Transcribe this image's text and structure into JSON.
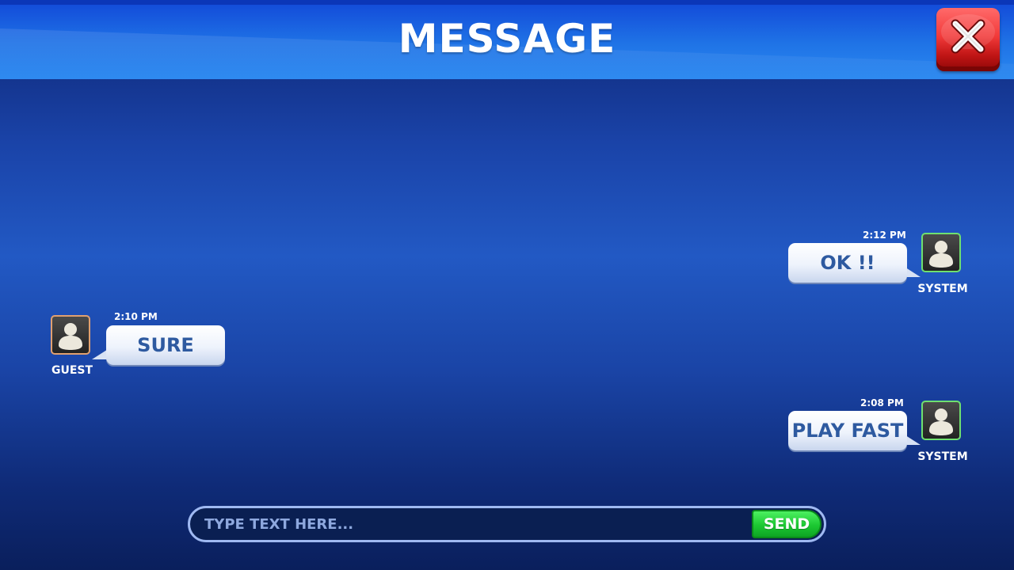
{
  "header": {
    "title": "MESSAGE",
    "close_icon": "close-x-icon",
    "colors": {
      "header_blue": "#1f73e6",
      "close_red": "#f23a3a"
    }
  },
  "messages": [
    {
      "sender": "SYSTEM",
      "time": "2:12 PM",
      "text": "OK !!",
      "side": "right",
      "avatar_icon": "user-silhouette-icon"
    },
    {
      "sender": "GUEST",
      "time": "2:10 PM",
      "text": "SURE",
      "side": "left",
      "avatar_icon": "user-silhouette-icon"
    },
    {
      "sender": "SYSTEM",
      "time": "2:08 PM",
      "text": "PLAY FAST",
      "side": "right",
      "avatar_icon": "user-silhouette-icon"
    }
  ],
  "composer": {
    "placeholder": "TYPE TEXT HERE...",
    "value": "",
    "send_label": "SEND",
    "colors": {
      "send_green": "#1cc832",
      "input_border": "#9fb9f2"
    }
  }
}
